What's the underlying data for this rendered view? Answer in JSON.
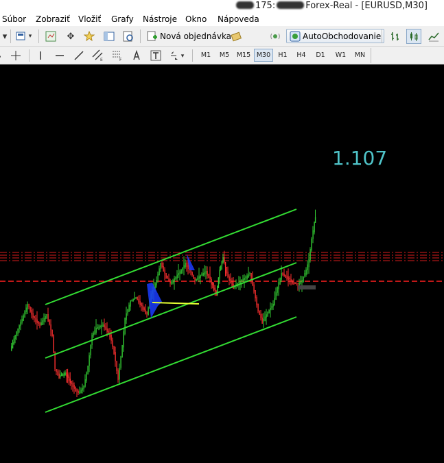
{
  "window": {
    "title_prefix": "175:",
    "title_suffix": "Forex-Real - [EURUSD,M30]"
  },
  "menu": [
    {
      "label": "Súbor"
    },
    {
      "label": "Zobraziť"
    },
    {
      "label": "Vložiť"
    },
    {
      "label": "Grafy"
    },
    {
      "label": "Nástroje"
    },
    {
      "label": "Okno"
    },
    {
      "label": "Nápoveda"
    }
  ],
  "toolbar": {
    "new_order_label": "Nová objednávka",
    "autotrading_label": "AutoObchodovanie"
  },
  "timeframes": [
    "M1",
    "M5",
    "M15",
    "M30",
    "H1",
    "H4",
    "D1",
    "W1",
    "MN"
  ],
  "active_timeframe": "M30",
  "chart": {
    "price_label": "1.107",
    "price_label_color": "#4fc3c8",
    "channel_color": "#33dd33",
    "level_color": "#ff2020",
    "bull_color": "#33cc33",
    "bear_color": "#ff3030"
  }
}
